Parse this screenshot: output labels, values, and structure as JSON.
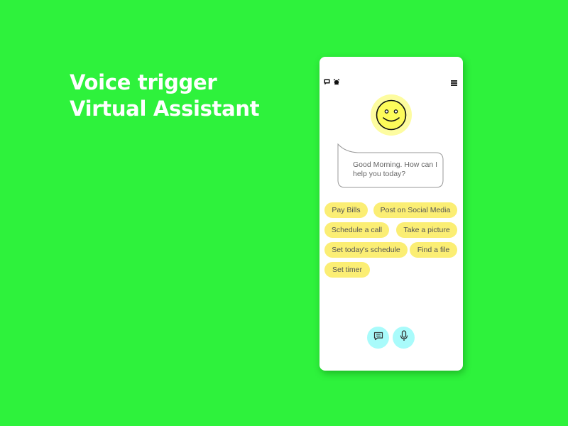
{
  "headline": {
    "line1": "Voice trigger",
    "line2": "Virtual Assistant"
  },
  "phone": {
    "topbar": {
      "left_icons": [
        "chat-icon",
        "alarm-icon"
      ],
      "right_icon": "menu-icon"
    },
    "assistant": {
      "avatar_icon": "smiley-face-icon",
      "message": "Good Morning. How can I help you today?"
    },
    "suggestions": [
      {
        "label": "Pay Bills"
      },
      {
        "label": "Post on Social Media"
      },
      {
        "label": "Schedule a call"
      },
      {
        "label": "Take a picture"
      },
      {
        "label": "Set today's schedule"
      },
      {
        "label": "Find a file"
      },
      {
        "label": "Set timer"
      }
    ],
    "actions": [
      {
        "icon": "chat-icon",
        "name": "text-input"
      },
      {
        "icon": "microphone-icon",
        "name": "voice-input"
      }
    ]
  },
  "colors": {
    "background": "#2ef23c",
    "chip": "#fbee74",
    "avatar": "#fdfb5a",
    "action_button": "#a9fbfb"
  }
}
